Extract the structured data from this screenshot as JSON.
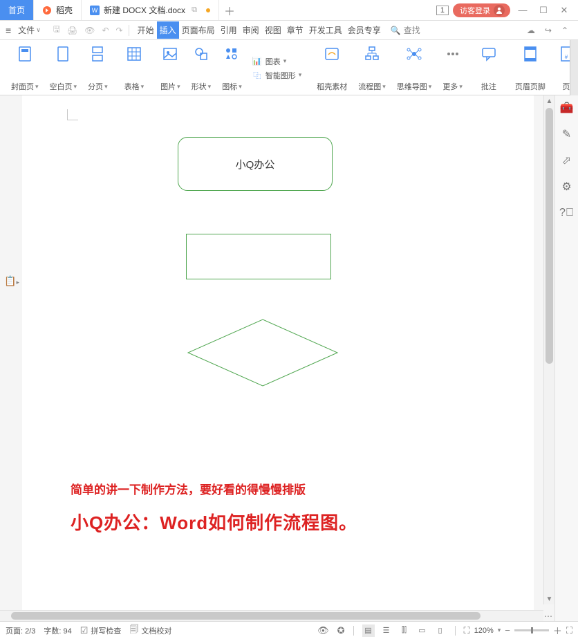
{
  "titlebar": {
    "home_label": "首页",
    "dk_label": "稻壳",
    "doc_label": "新建 DOCX 文档.docx",
    "badge": "1",
    "login_label": "访客登录"
  },
  "menubar": {
    "file_label": "文件",
    "menus": [
      "开始",
      "插入",
      "页面布局",
      "引用",
      "审阅",
      "视图",
      "章节",
      "开发工具",
      "会员专享"
    ],
    "active_index": 1,
    "search_label": "查找"
  },
  "ribbon": {
    "cover": "封面页",
    "blank": "空白页",
    "pagebreak": "分页",
    "table": "表格",
    "picture": "图片",
    "shape": "形状",
    "icon": "图标",
    "chart": "图表",
    "smartart": "智能图形",
    "dk_assets": "稻壳素材",
    "flowchart": "流程图",
    "mindmap": "思维导图",
    "more": "更多",
    "comment": "批注",
    "header": "页眉页脚",
    "pagenum": "页"
  },
  "doc": {
    "shape1_text": "小Q办公",
    "red1": "简单的讲一下制作方法，要好看的得慢慢排版",
    "red2": "小Q办公：Word如何制作流程图。"
  },
  "statusbar": {
    "page": "页面: 2/3",
    "words": "字数: 94",
    "spell": "拼写检查",
    "proof": "文档校对",
    "zoom": "120%"
  }
}
